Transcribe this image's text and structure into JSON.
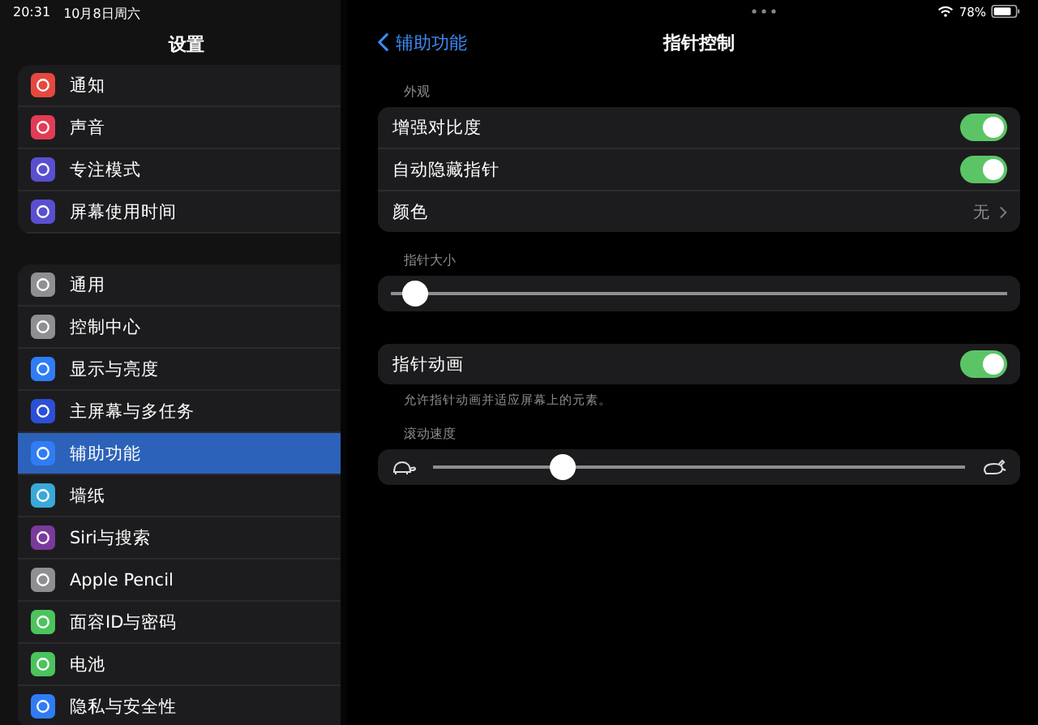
{
  "status_bar": {
    "time": "20:31",
    "date": "10月8日周六",
    "battery": "78%"
  },
  "sidebar": {
    "title": "设置",
    "groups": [
      [
        {
          "label": "通知",
          "color": "#e5483f",
          "selected": false
        },
        {
          "label": "声音",
          "color": "#e23b56",
          "selected": false
        },
        {
          "label": "专注模式",
          "color": "#5a4fcf",
          "selected": false
        },
        {
          "label": "屏幕使用时间",
          "color": "#5a4fcf",
          "selected": false
        }
      ],
      [
        {
          "label": "通用",
          "color": "#8e8e93",
          "selected": false
        },
        {
          "label": "控制中心",
          "color": "#8e8e93",
          "selected": false
        },
        {
          "label": "显示与亮度",
          "color": "#2f7cf6",
          "selected": false
        },
        {
          "label": "主屏幕与多任务",
          "color": "#2c4fd8",
          "selected": false
        },
        {
          "label": "辅助功能",
          "color": "#2f7cf6",
          "selected": true
        },
        {
          "label": "墙纸",
          "color": "#3aa8d8",
          "selected": false
        },
        {
          "label": "Siri与搜索",
          "color": "#7a3a9a",
          "selected": false
        },
        {
          "label": "Apple Pencil",
          "color": "#8e8e93",
          "selected": false
        },
        {
          "label": "面容ID与密码",
          "color": "#4cc35d",
          "selected": false
        },
        {
          "label": "电池",
          "color": "#4cc35d",
          "selected": false
        },
        {
          "label": "隐私与安全性",
          "color": "#2f7cf6",
          "selected": false
        }
      ]
    ]
  },
  "detail": {
    "back": "辅助功能",
    "title": "指针控制",
    "appearance": {
      "header": "外观",
      "rows": [
        {
          "kind": "toggle",
          "label": "增强对比度",
          "on": true
        },
        {
          "kind": "toggle",
          "label": "自动隐藏指针",
          "on": true
        },
        {
          "kind": "link",
          "label": "颜色",
          "value": "无"
        }
      ]
    },
    "pointer_size": {
      "header": "指针大小",
      "level": 0.02
    },
    "animation": {
      "label": "指针动画",
      "on": true,
      "footer": "允许指针动画并适应屏幕上的元素。"
    },
    "scroll_speed": {
      "header": "滚动速度",
      "level": 0.23
    }
  }
}
